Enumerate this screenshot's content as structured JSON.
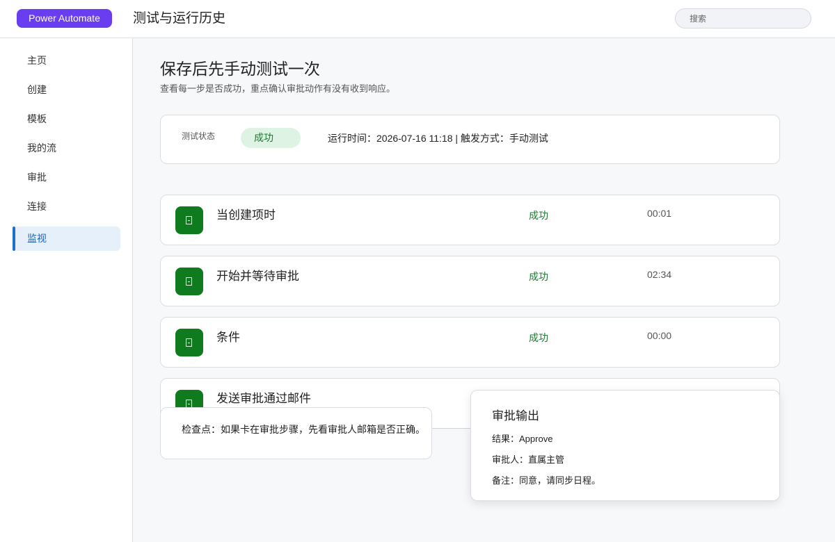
{
  "header": {
    "brand": "Power Automate",
    "title": "测试与运行历史",
    "search_placeholder": "搜索"
  },
  "sidebar": {
    "items": [
      {
        "label": "主页",
        "active": false
      },
      {
        "label": "创建",
        "active": false
      },
      {
        "label": "模板",
        "active": false
      },
      {
        "label": "我的流",
        "active": false
      },
      {
        "label": "审批",
        "active": false
      },
      {
        "label": "连接",
        "active": false
      },
      {
        "label": "监视",
        "active": true
      }
    ]
  },
  "main": {
    "title": "保存后先手动测试一次",
    "subtitle": "查看每一步是否成功，重点确认审批动作有没有收到响应。",
    "status": {
      "label": "测试状态",
      "value": "成功",
      "meta": "运行时间：2026-07-16 11:18 | 触发方式：手动测试"
    },
    "steps": [
      {
        "name": "当创建项时",
        "status": "成功",
        "duration": "00:01"
      },
      {
        "name": "开始并等待审批",
        "status": "成功",
        "duration": "02:34"
      },
      {
        "name": "条件",
        "status": "成功",
        "duration": "00:00"
      },
      {
        "name": "发送审批通过邮件"
      }
    ],
    "checkpoint": "检查点：如果卡在审批步骤，先看审批人邮箱是否正确。",
    "approval_output": {
      "title": "审批输出",
      "lines": [
        "结果：Approve",
        "审批人：直属主管",
        "备注：同意，请同步日程。"
      ]
    }
  },
  "colors": {
    "brand": "#6a3df0",
    "success": "#1b7a2e",
    "step_icon": "#0f7b1e",
    "active_nav": "#1e6fd0"
  },
  "icons": {
    "step": "document-icon"
  }
}
